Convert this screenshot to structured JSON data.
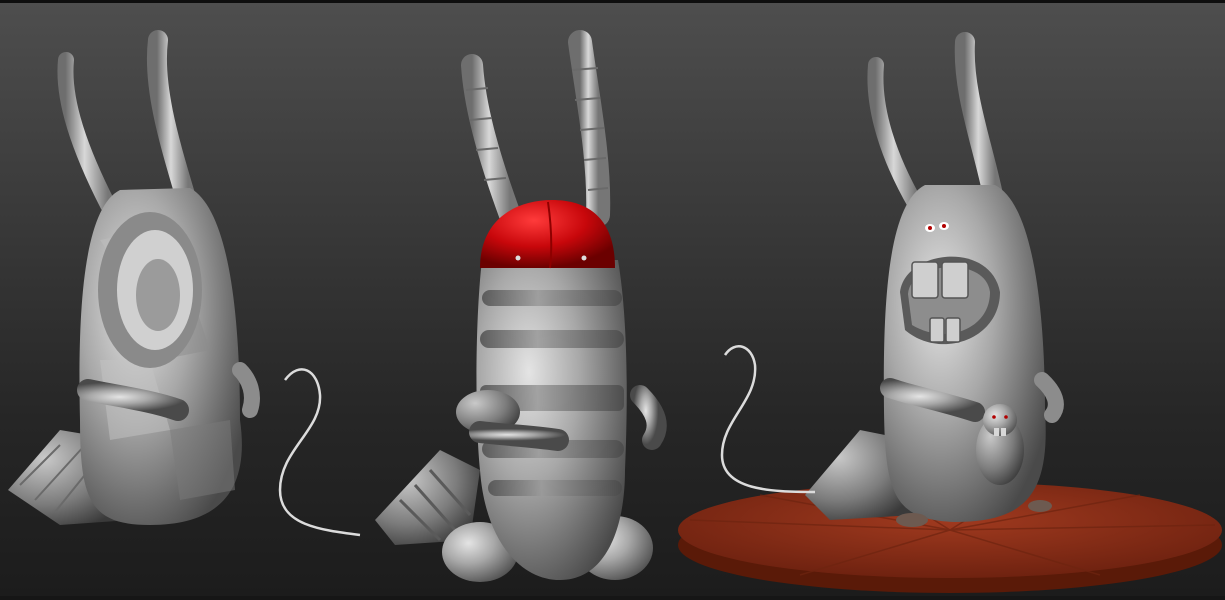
{
  "scene": {
    "background_top": "#4e4e4e",
    "background_bottom": "#1c1c1c",
    "clay_color": "#a9a9a9",
    "clay_dark": "#5a5a5a",
    "helmet_color": "#c8070b",
    "base_color": "#8a2d17",
    "models": [
      "faceted-sculpt",
      "segmented-sculpt",
      "detailed-sculpt-on-base"
    ]
  }
}
